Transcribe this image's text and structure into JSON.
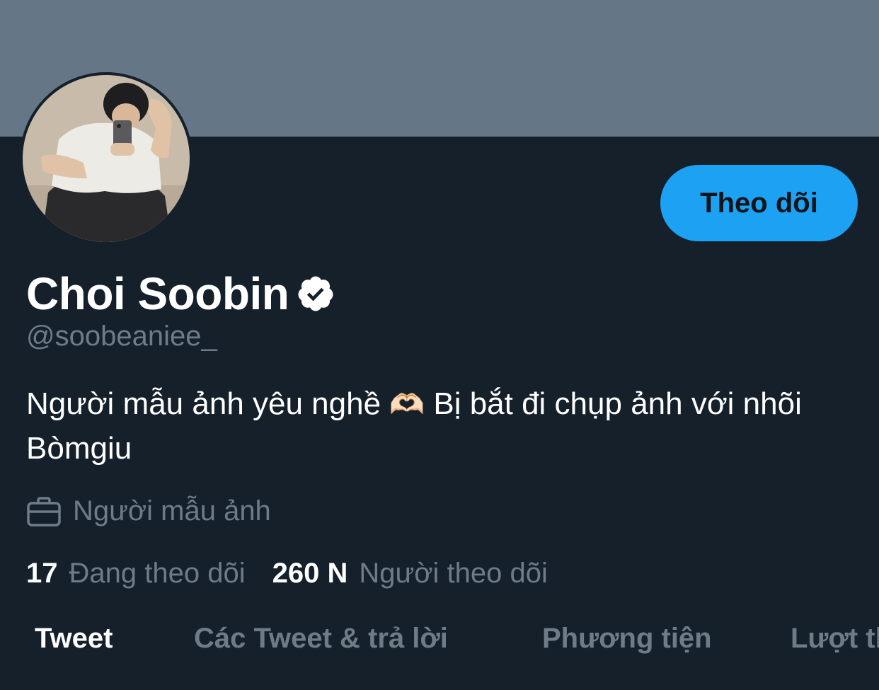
{
  "profile": {
    "display_name": "Choi Soobin",
    "handle": "@soobeaniee_",
    "bio_part1": "Người mẫu ảnh yêu nghề",
    "bio_emoji": "🫶🏻",
    "bio_part2": "Bị bắt đi chụp ảnh với nhõi Bòmgiu",
    "profession": "Người mẫu ảnh",
    "verified_icon": "verified-badge-icon",
    "profession_icon": "briefcase-icon"
  },
  "actions": {
    "follow_label": "Theo dõi"
  },
  "stats": {
    "following_count": "17",
    "following_label": "Đang theo dõi",
    "followers_count": "260 N",
    "followers_label": "Người theo dõi"
  },
  "tabs": [
    {
      "label": "Tweet",
      "active": true
    },
    {
      "label": "Các Tweet & trả lời",
      "active": false
    },
    {
      "label": "Phương tiện",
      "active": false
    },
    {
      "label": "Lượt thích",
      "active": false
    }
  ],
  "colors": {
    "banner": "#657786",
    "background": "#15202b",
    "accent": "#1da1f2",
    "secondary_text": "#6e7c89"
  }
}
